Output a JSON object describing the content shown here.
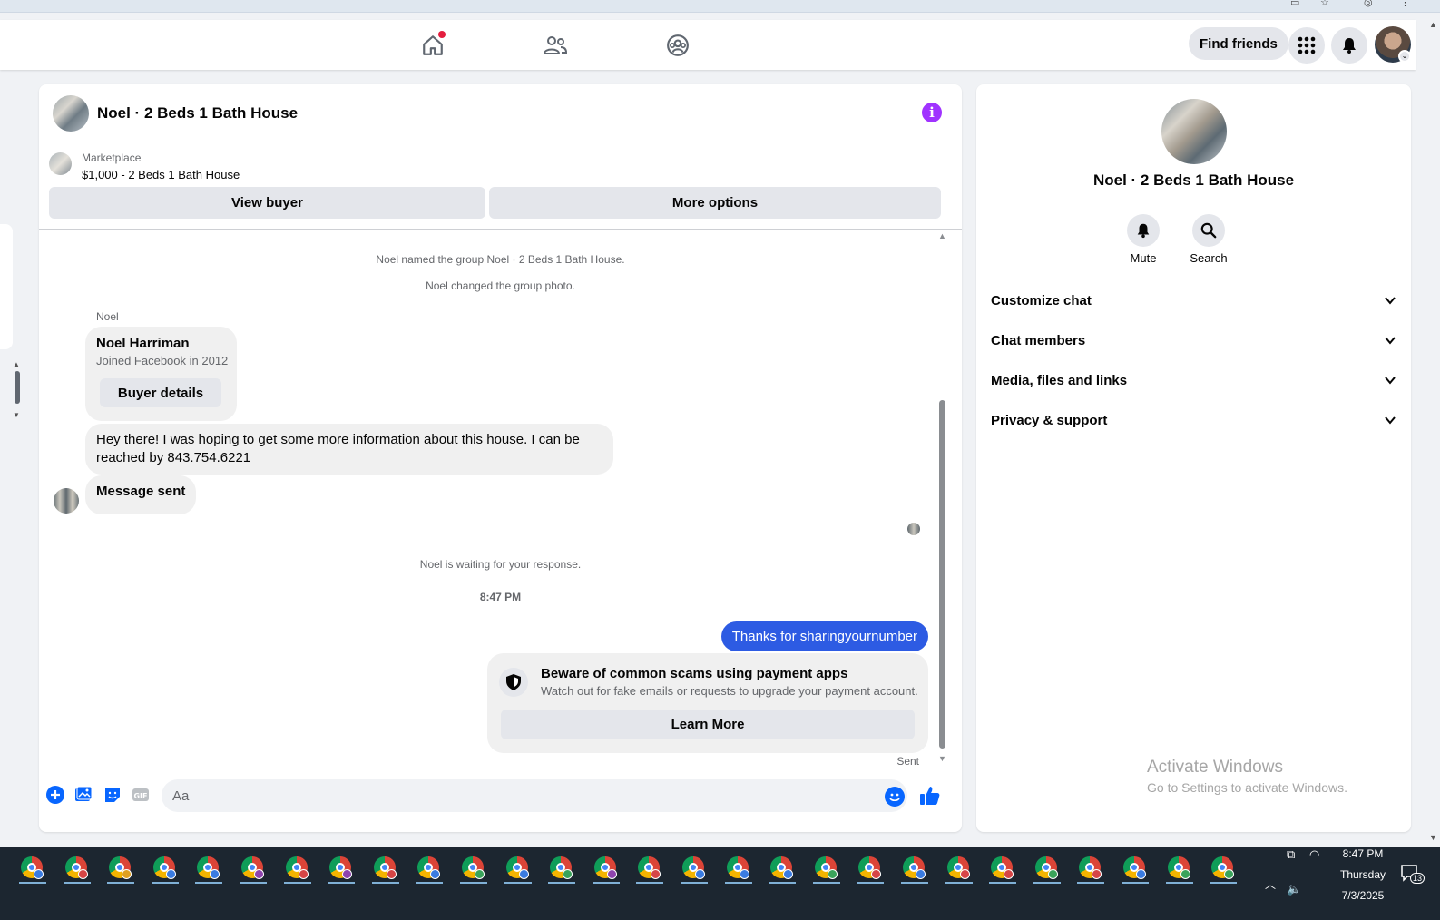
{
  "nav": {
    "find_friends": "Find friends",
    "icons": [
      "home-icon",
      "friends-icon",
      "groups-icon",
      "apps-grid-icon",
      "bell-icon"
    ]
  },
  "chat": {
    "title": "Noel · 2 Beds 1 Bath House",
    "marketplace_label": "Marketplace",
    "listing": "$1,000 - 2 Beds 1 Bath House",
    "view_buyer": "View buyer",
    "more_options": "More options",
    "system_1": "Noel named the group Noel · 2 Beds 1 Bath House.",
    "system_2": "Noel changed the group photo.",
    "sender": "Noel",
    "contact": {
      "name": "Noel Harriman",
      "joined": "Joined Facebook in 2012",
      "button": "Buyer details"
    },
    "message_1_line1": "Hey there! I was hoping to get some more information about this house. I can be",
    "message_1_line2": "reached by 843.754.6221",
    "message_2": "Message sent",
    "waiting": "Noel is waiting for your response.",
    "time": "8:47 PM",
    "outgoing": "Thanks for sharingyournumber",
    "scam": {
      "title": "Beware of common scams using payment apps",
      "desc": "Watch out for fake emails or requests to upgrade your payment account.",
      "button": "Learn More"
    },
    "sent": "Sent",
    "composer_placeholder": "Aa"
  },
  "info": {
    "title": "Noel · 2 Beds 1 Bath House",
    "mute": "Mute",
    "search": "Search",
    "sections": [
      "Customize chat",
      "Chat members",
      "Media, files and links",
      "Privacy & support"
    ]
  },
  "watermark": {
    "line1": "Activate Windows",
    "line2": "Go to Settings to activate Windows."
  },
  "taskbar": {
    "time": "8:47 PM",
    "day": "Thursday",
    "date": "7/3/2025",
    "notifications": "13",
    "badge_colors": [
      "#3a7be0",
      "#d64545",
      "#e0a020",
      "#3a7be0",
      "#3a7be0",
      "#8e44ad",
      "#d64545",
      "#8e44ad",
      "#d64545",
      "#3a7be0",
      "#3aa35a",
      "#3a7be0",
      "#3aa35a",
      "#8e44ad",
      "#d64545",
      "#3a7be0",
      "#3a7be0",
      "#3a7be0",
      "#3aa35a",
      "#d64545",
      "#3a7be0",
      "#d64545",
      "#d64545",
      "#3aa35a",
      "#d64545",
      "#3a7be0",
      "#3aa35a",
      "#3aa35a"
    ]
  },
  "colors": {
    "accent": "#2d5be3",
    "info_purple": "#a033ff",
    "nav_badge": "#e41e3f"
  }
}
